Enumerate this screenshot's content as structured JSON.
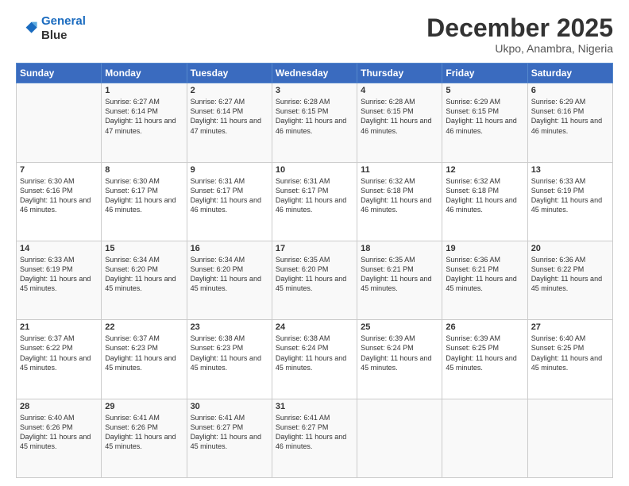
{
  "logo": {
    "line1": "General",
    "line2": "Blue"
  },
  "header": {
    "month": "December 2025",
    "location": "Ukpo, Anambra, Nigeria"
  },
  "weekdays": [
    "Sunday",
    "Monday",
    "Tuesday",
    "Wednesday",
    "Thursday",
    "Friday",
    "Saturday"
  ],
  "weeks": [
    [
      {
        "day": "",
        "empty": true
      },
      {
        "day": "1",
        "sunrise": "6:27 AM",
        "sunset": "6:14 PM",
        "daylight": "11 hours and 47 minutes."
      },
      {
        "day": "2",
        "sunrise": "6:27 AM",
        "sunset": "6:14 PM",
        "daylight": "11 hours and 47 minutes."
      },
      {
        "day": "3",
        "sunrise": "6:28 AM",
        "sunset": "6:15 PM",
        "daylight": "11 hours and 46 minutes."
      },
      {
        "day": "4",
        "sunrise": "6:28 AM",
        "sunset": "6:15 PM",
        "daylight": "11 hours and 46 minutes."
      },
      {
        "day": "5",
        "sunrise": "6:29 AM",
        "sunset": "6:15 PM",
        "daylight": "11 hours and 46 minutes."
      },
      {
        "day": "6",
        "sunrise": "6:29 AM",
        "sunset": "6:16 PM",
        "daylight": "11 hours and 46 minutes."
      }
    ],
    [
      {
        "day": "7",
        "sunrise": "6:30 AM",
        "sunset": "6:16 PM",
        "daylight": "11 hours and 46 minutes."
      },
      {
        "day": "8",
        "sunrise": "6:30 AM",
        "sunset": "6:17 PM",
        "daylight": "11 hours and 46 minutes."
      },
      {
        "day": "9",
        "sunrise": "6:31 AM",
        "sunset": "6:17 PM",
        "daylight": "11 hours and 46 minutes."
      },
      {
        "day": "10",
        "sunrise": "6:31 AM",
        "sunset": "6:17 PM",
        "daylight": "11 hours and 46 minutes."
      },
      {
        "day": "11",
        "sunrise": "6:32 AM",
        "sunset": "6:18 PM",
        "daylight": "11 hours and 46 minutes."
      },
      {
        "day": "12",
        "sunrise": "6:32 AM",
        "sunset": "6:18 PM",
        "daylight": "11 hours and 46 minutes."
      },
      {
        "day": "13",
        "sunrise": "6:33 AM",
        "sunset": "6:19 PM",
        "daylight": "11 hours and 45 minutes."
      }
    ],
    [
      {
        "day": "14",
        "sunrise": "6:33 AM",
        "sunset": "6:19 PM",
        "daylight": "11 hours and 45 minutes."
      },
      {
        "day": "15",
        "sunrise": "6:34 AM",
        "sunset": "6:20 PM",
        "daylight": "11 hours and 45 minutes."
      },
      {
        "day": "16",
        "sunrise": "6:34 AM",
        "sunset": "6:20 PM",
        "daylight": "11 hours and 45 minutes."
      },
      {
        "day": "17",
        "sunrise": "6:35 AM",
        "sunset": "6:20 PM",
        "daylight": "11 hours and 45 minutes."
      },
      {
        "day": "18",
        "sunrise": "6:35 AM",
        "sunset": "6:21 PM",
        "daylight": "11 hours and 45 minutes."
      },
      {
        "day": "19",
        "sunrise": "6:36 AM",
        "sunset": "6:21 PM",
        "daylight": "11 hours and 45 minutes."
      },
      {
        "day": "20",
        "sunrise": "6:36 AM",
        "sunset": "6:22 PM",
        "daylight": "11 hours and 45 minutes."
      }
    ],
    [
      {
        "day": "21",
        "sunrise": "6:37 AM",
        "sunset": "6:22 PM",
        "daylight": "11 hours and 45 minutes."
      },
      {
        "day": "22",
        "sunrise": "6:37 AM",
        "sunset": "6:23 PM",
        "daylight": "11 hours and 45 minutes."
      },
      {
        "day": "23",
        "sunrise": "6:38 AM",
        "sunset": "6:23 PM",
        "daylight": "11 hours and 45 minutes."
      },
      {
        "day": "24",
        "sunrise": "6:38 AM",
        "sunset": "6:24 PM",
        "daylight": "11 hours and 45 minutes."
      },
      {
        "day": "25",
        "sunrise": "6:39 AM",
        "sunset": "6:24 PM",
        "daylight": "11 hours and 45 minutes."
      },
      {
        "day": "26",
        "sunrise": "6:39 AM",
        "sunset": "6:25 PM",
        "daylight": "11 hours and 45 minutes."
      },
      {
        "day": "27",
        "sunrise": "6:40 AM",
        "sunset": "6:25 PM",
        "daylight": "11 hours and 45 minutes."
      }
    ],
    [
      {
        "day": "28",
        "sunrise": "6:40 AM",
        "sunset": "6:26 PM",
        "daylight": "11 hours and 45 minutes."
      },
      {
        "day": "29",
        "sunrise": "6:41 AM",
        "sunset": "6:26 PM",
        "daylight": "11 hours and 45 minutes."
      },
      {
        "day": "30",
        "sunrise": "6:41 AM",
        "sunset": "6:27 PM",
        "daylight": "11 hours and 45 minutes."
      },
      {
        "day": "31",
        "sunrise": "6:41 AM",
        "sunset": "6:27 PM",
        "daylight": "11 hours and 46 minutes."
      },
      {
        "day": "",
        "empty": true
      },
      {
        "day": "",
        "empty": true
      },
      {
        "day": "",
        "empty": true
      }
    ]
  ]
}
